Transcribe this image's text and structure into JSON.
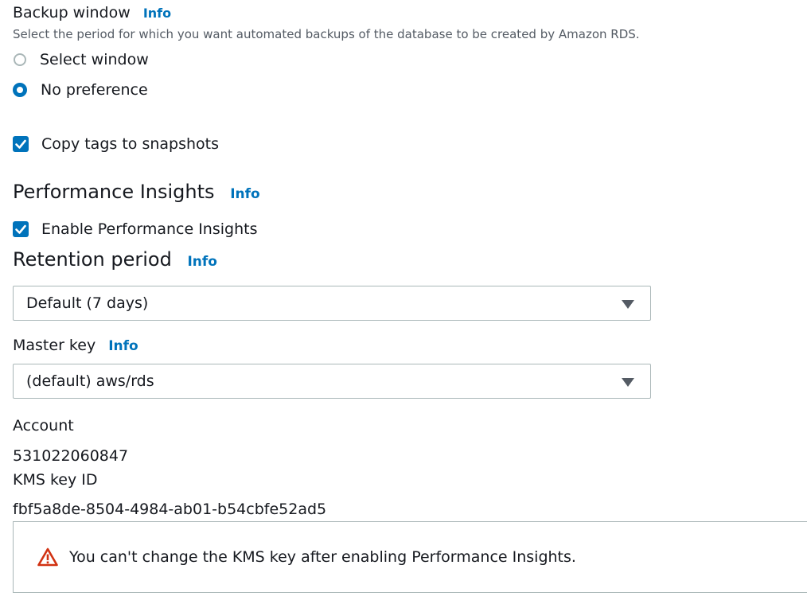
{
  "backup_window": {
    "label": "Backup window",
    "info": "Info",
    "description": "Select the period for which you want automated backups of the database to be created by Amazon RDS.",
    "options": [
      {
        "label": "Select window",
        "selected": false
      },
      {
        "label": "No preference",
        "selected": true
      }
    ]
  },
  "copy_tags": {
    "label": "Copy tags to snapshots",
    "checked": true
  },
  "performance_insights": {
    "title": "Performance Insights",
    "info": "Info",
    "enable_label": "Enable Performance Insights",
    "enabled": true
  },
  "retention_period": {
    "title": "Retention period",
    "info": "Info",
    "selected": "Default (7 days)"
  },
  "master_key": {
    "label": "Master key",
    "info": "Info",
    "selected": "(default) aws/rds"
  },
  "account": {
    "label": "Account",
    "value": "531022060847"
  },
  "kms_key": {
    "label": "KMS key ID",
    "value": "fbf5a8de-8504-4984-ab01-b54cbfe52ad5"
  },
  "warning": {
    "text": "You can't change the KMS key after enabling Performance Insights."
  },
  "colors": {
    "accent": "#0073bb",
    "warning": "#d13212",
    "border": "#aab7b8"
  },
  "icons": {
    "dropdown": "caret-down-icon",
    "warning": "warning-icon",
    "check": "checkmark-icon"
  }
}
